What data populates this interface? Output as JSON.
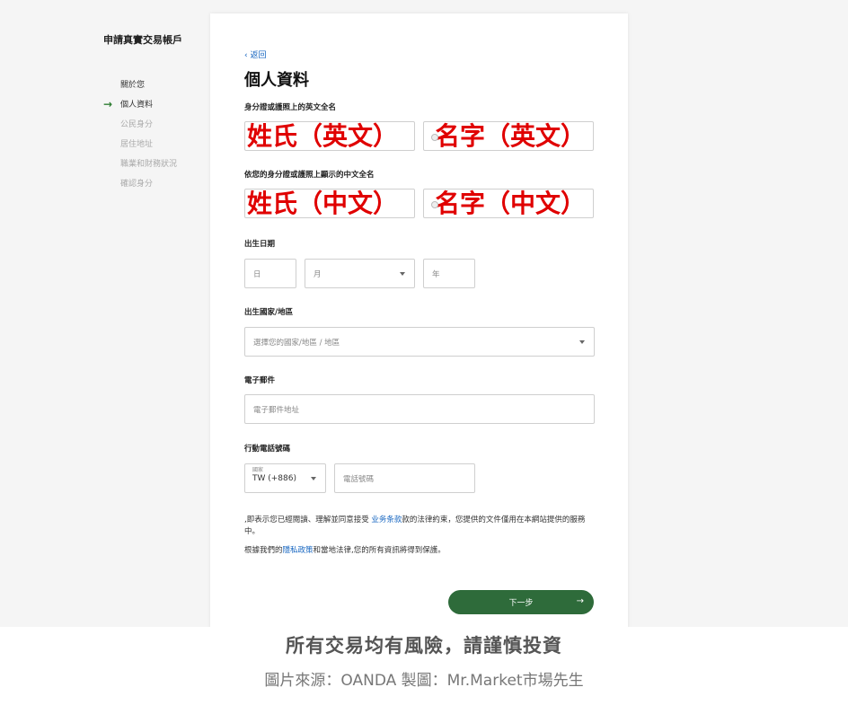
{
  "sidebar": {
    "title": "申請真實交易帳戶",
    "steps": [
      {
        "label": "關於您",
        "state": "done"
      },
      {
        "label": "個人資料",
        "state": "current"
      },
      {
        "label": "公民身分",
        "state": "todo"
      },
      {
        "label": "居住地址",
        "state": "todo"
      },
      {
        "label": "職業和財務狀況",
        "state": "todo"
      },
      {
        "label": "確認身分",
        "state": "todo"
      }
    ],
    "current_arrow": "→"
  },
  "form": {
    "back_label": "‹ 返回",
    "title": "個人資料",
    "english_name_label": "身分證或護照上的英文全名",
    "english_surname_overlay": "姓氏（英文）",
    "english_given_overlay": "名字（英文）",
    "chinese_name_label": "依您的身分證或護照上顯示的中文全名",
    "chinese_surname_overlay": "姓氏（中文）",
    "chinese_given_overlay": "名字（中文）",
    "dob_label": "出生日期",
    "dob_day_placeholder": "日",
    "dob_month_placeholder": "月",
    "dob_year_placeholder": "年",
    "country_label": "出生國家/地區",
    "country_placeholder": "選擇您的國家/地區 / 地區",
    "email_label": "電子郵件",
    "email_placeholder": "電子郵件地址",
    "phone_label": "行動電話號碼",
    "phone_country_label": "國家",
    "phone_country_value": "TW (+886)",
    "phone_placeholder": "電話號碼",
    "legal_prefix": ",即表示您已經閱讀、理解並同意接受 ",
    "legal_link": "业务条款",
    "legal_suffix": "款的法律約束，您提供的文件僅用在本網站提供的服務中。",
    "privacy_prefix": "根據我們的",
    "privacy_link": "隱私政策",
    "privacy_suffix": "和當地法律,您的所有資訊將得到保護。",
    "next_label": "下一步",
    "next_arrow": "→"
  },
  "footer": {
    "title": "所有交易均有風險，請謹慎投資",
    "source": "圖片來源：OANDA 製圖：Mr.Market市場先生"
  },
  "colors": {
    "accent_green": "#2e6b3a",
    "link_blue": "#1565c0",
    "overlay_red": "#e00000"
  }
}
